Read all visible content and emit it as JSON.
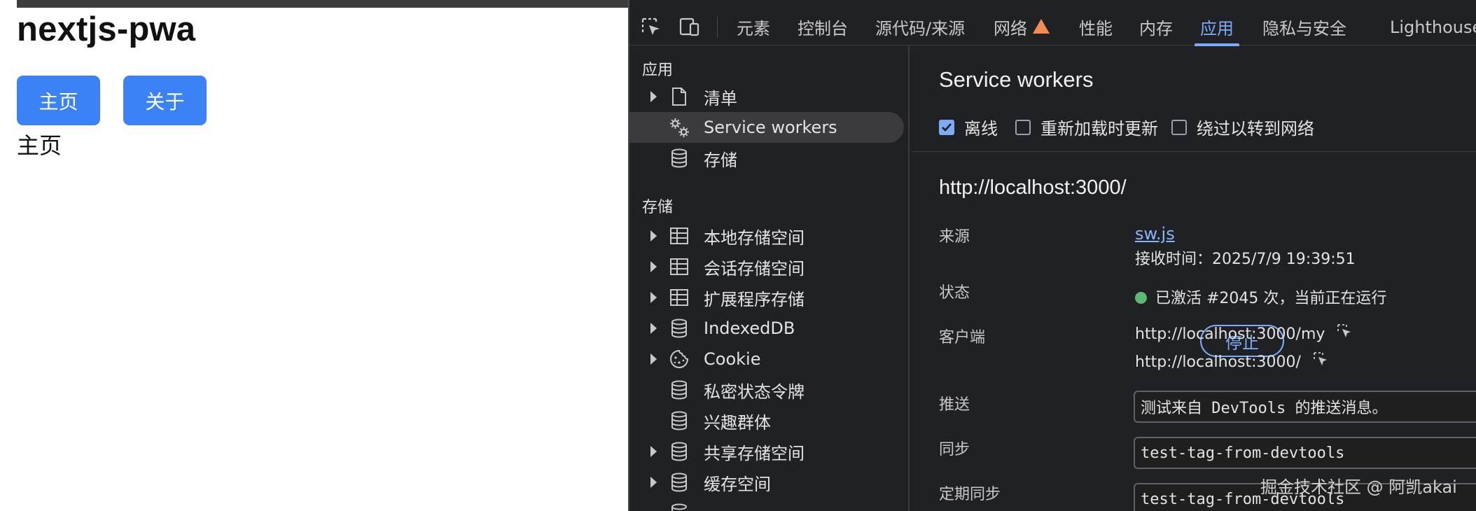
{
  "page": {
    "title": "nextjs-pwa",
    "nav": {
      "home_label": "主页",
      "about_label": "关于"
    },
    "content": "主页"
  },
  "devtools": {
    "tabs": [
      {
        "label": "元素",
        "active": false
      },
      {
        "label": "控制台",
        "active": false
      },
      {
        "label": "源代码/来源",
        "active": false
      },
      {
        "label": "网络",
        "active": false,
        "warning": true
      },
      {
        "label": "性能",
        "active": false
      },
      {
        "label": "内存",
        "active": false
      },
      {
        "label": "应用",
        "active": true
      },
      {
        "label": "隐私与安全",
        "active": false
      },
      {
        "label": "Lighthouse",
        "active": false
      }
    ],
    "sidebar": {
      "section_app": "应用",
      "app_items": [
        {
          "label": "清单",
          "icon": "document-icon",
          "expandable": true
        },
        {
          "label": "Service workers",
          "icon": "gears-icon",
          "expandable": false,
          "selected": true
        },
        {
          "label": "存储",
          "icon": "database-icon",
          "expandable": false
        }
      ],
      "section_storage": "存储",
      "storage_items": [
        {
          "label": "本地存储空间",
          "icon": "table-icon",
          "expandable": true
        },
        {
          "label": "会话存储空间",
          "icon": "table-icon",
          "expandable": true
        },
        {
          "label": "扩展程序存储",
          "icon": "table-icon",
          "expandable": true
        },
        {
          "label": "IndexedDB",
          "icon": "database-icon",
          "expandable": true
        },
        {
          "label": "Cookie",
          "icon": "cookie-icon",
          "expandable": true
        },
        {
          "label": "私密状态令牌",
          "icon": "database-icon",
          "expandable": false
        },
        {
          "label": "兴趣群体",
          "icon": "database-icon",
          "expandable": false
        },
        {
          "label": "共享存储空间",
          "icon": "database-icon",
          "expandable": true
        },
        {
          "label": "缓存空间",
          "icon": "database-icon",
          "expandable": true
        }
      ]
    },
    "main": {
      "title": "Service workers",
      "checkboxes": [
        {
          "label": "离线",
          "checked": true
        },
        {
          "label": "重新加载时更新",
          "checked": false
        },
        {
          "label": "绕过以转到网络",
          "checked": false
        }
      ],
      "origin": "http://localhost:3000/",
      "source_label": "来源",
      "source_link": "sw.js",
      "received": "接收时间：2025/7/9 19:39:51",
      "status_label": "状态",
      "status_text": "已激活 #2045 次，当前正在运行",
      "stop_label": "停止",
      "clients_label": "客户端",
      "clients": [
        "http://localhost:3000/my",
        "http://localhost:3000/"
      ],
      "push_label": "推送",
      "push_value": "测试来自 DevTools 的推送消息。",
      "sync_label": "同步",
      "sync_value": "test-tag-from-devtools",
      "periodic_label": "定期同步",
      "periodic_value": "test-tag-from-devtools"
    }
  },
  "watermark": "掘金技术社区 @ 阿凯akai",
  "colors": {
    "accent": "#7cacf8",
    "button_blue": "#3b82f6",
    "devtools_bg": "#202124",
    "status_green": "#5bb974",
    "warning": "#f28b54"
  }
}
